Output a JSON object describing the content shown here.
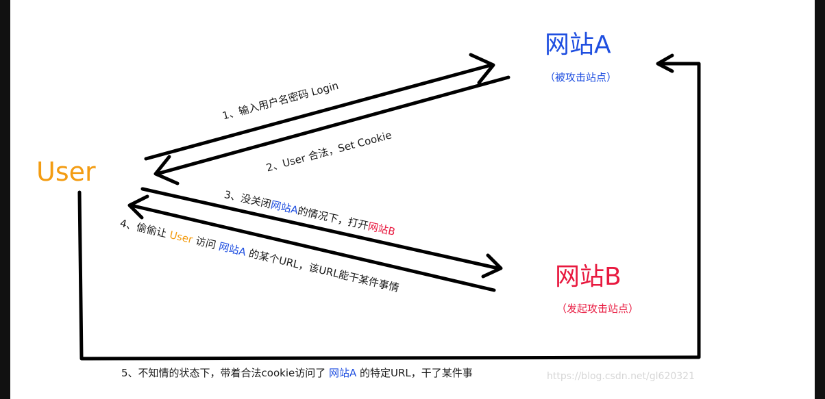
{
  "colors": {
    "user": "#f39c12",
    "site_a": "#1f4fe0",
    "site_b": "#e8193f",
    "text": "#1a1a1a",
    "watermark": "#d6d6d6"
  },
  "nodes": {
    "site_a": {
      "title": "网站A",
      "subtitle": "（被攻击站点）"
    },
    "site_b": {
      "title": "网站B",
      "subtitle": "（发起攻击站点）"
    },
    "user": {
      "title": "User"
    }
  },
  "edges": {
    "e1": {
      "label": "1、输入用户名密码 Login"
    },
    "e2": {
      "label": "2、User 合法，Set Cookie"
    },
    "e3": {
      "prefix": "3、没关闭",
      "site_a": "网站A",
      "middle": "的情况下，打开",
      "site_b": "网站B"
    },
    "e4": {
      "prefix": "4、偷偷让 ",
      "user": "User",
      "middle": " 访问 ",
      "site_a": "网站A",
      "suffix": " 的某个URL，该URL能干某件事情"
    },
    "e5": {
      "prefix": "5、不知情的状态下，带着合法cookie访问了 ",
      "site_a": "网站A",
      "suffix": " 的特定URL，干了某件事"
    }
  },
  "watermark": "https://blog.csdn.net/gl620321"
}
